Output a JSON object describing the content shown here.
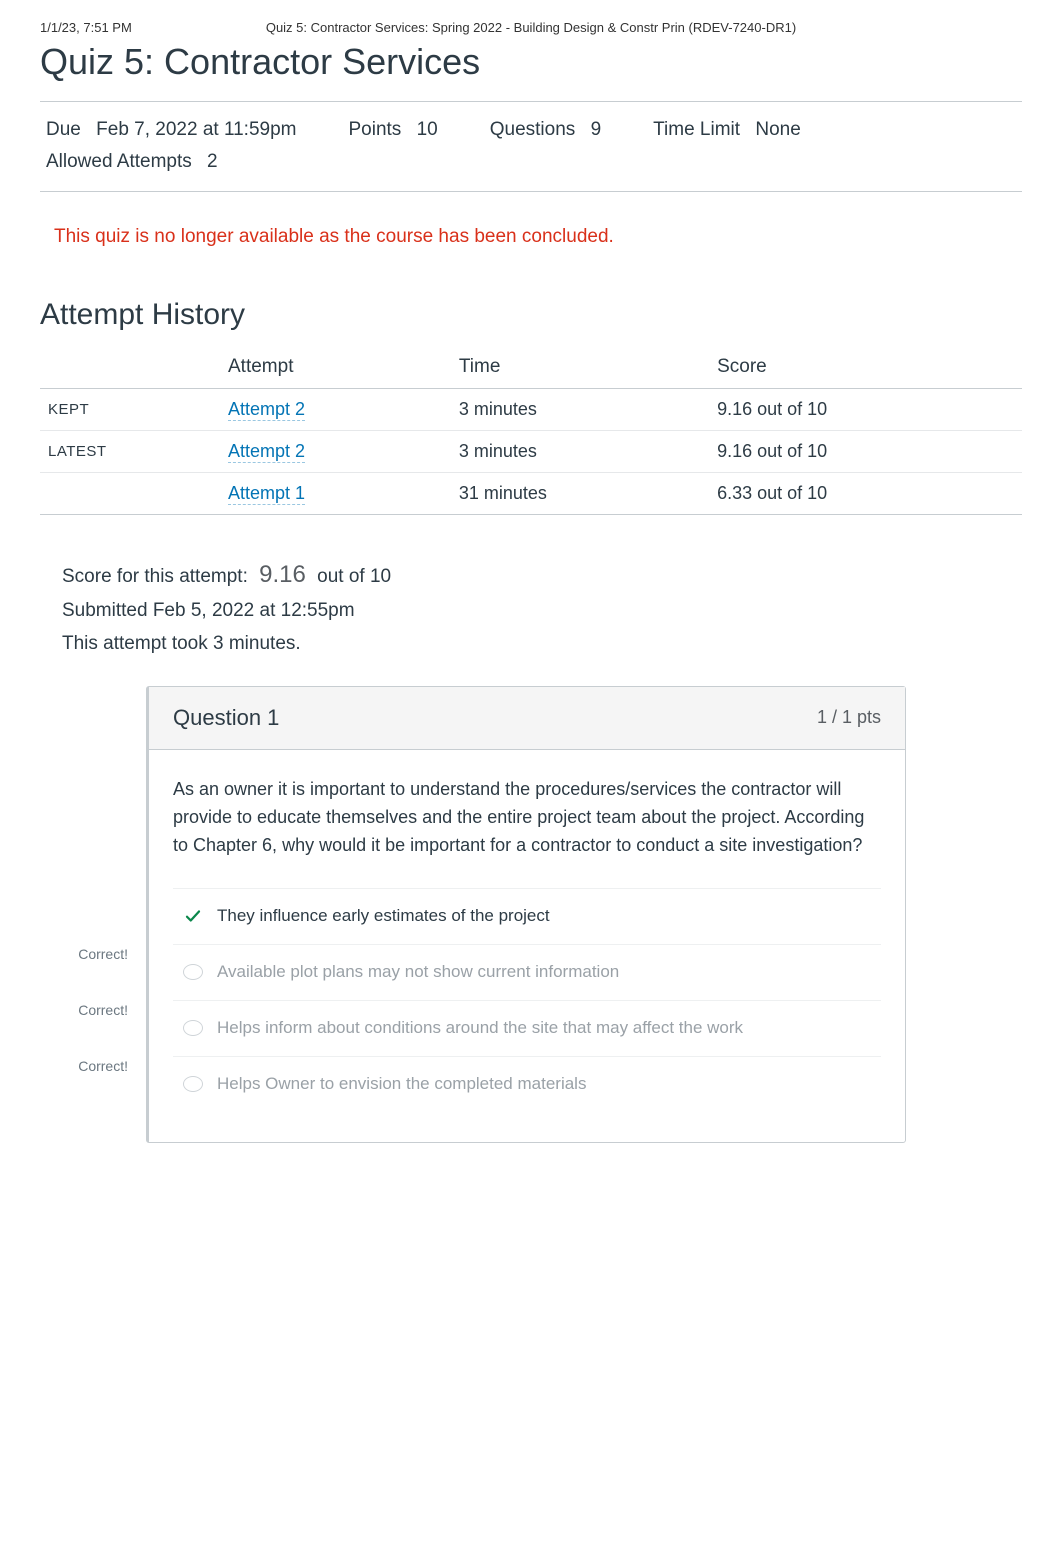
{
  "print_header": {
    "timestamp": "1/1/23, 7:51 PM",
    "doc_title": "Quiz 5: Contractor Services: Spring 2022 - Building Design & Constr Prin (RDEV-7240-DR1)"
  },
  "page_title": "Quiz 5: Contractor Services",
  "meta": {
    "due_label": "Due",
    "due_value": "Feb 7, 2022 at 11:59pm",
    "points_label": "Points",
    "points_value": "10",
    "questions_label": "Questions",
    "questions_value": "9",
    "time_limit_label": "Time Limit",
    "time_limit_value": "None",
    "allowed_attempts_label": "Allowed Attempts",
    "allowed_attempts_value": "2"
  },
  "notice": "This quiz is no longer available as the course has been concluded.",
  "attempt_history": {
    "heading": "Attempt History",
    "columns": {
      "tag": "",
      "attempt": "Attempt",
      "time": "Time",
      "score": "Score"
    },
    "rows": [
      {
        "tag": "KEPT",
        "attempt": "Attempt 2",
        "time": "3 minutes",
        "score": "9.16 out of 10"
      },
      {
        "tag": "LATEST",
        "attempt": "Attempt 2",
        "time": "3 minutes",
        "score": "9.16 out of 10"
      },
      {
        "tag": "",
        "attempt": "Attempt 1",
        "time": "31 minutes",
        "score": "6.33 out of 10"
      }
    ]
  },
  "summary": {
    "score_label": "Score for this attempt:",
    "score_value": "9.16",
    "score_suffix": "out of 10",
    "submitted": "Submitted Feb 5, 2022 at 12:55pm",
    "duration": "This attempt took 3 minutes."
  },
  "question": {
    "title": "Question 1",
    "points": "1 / 1 pts",
    "text": "As an owner it is important to understand the procedures/services the contractor will provide to educate themselves and the entire project team about the project. According to Chapter 6, why would it be important for a contractor to conduct a site investigation?",
    "answers": [
      {
        "label": "They influence early estimates of the project",
        "state": "selected",
        "gutter": "Correct!"
      },
      {
        "label": "Available plot plans may not show current information",
        "state": "correct-faded",
        "gutter": "Correct!"
      },
      {
        "label": "Helps inform about conditions around the site that may affect the work",
        "state": "correct-faded",
        "gutter": "Correct!"
      },
      {
        "label": "Helps Owner to envision the completed materials",
        "state": "faded",
        "gutter": ""
      }
    ]
  },
  "colors": {
    "link": "#0374b5",
    "warning": "#d9301a",
    "correct": "#0b874b"
  }
}
